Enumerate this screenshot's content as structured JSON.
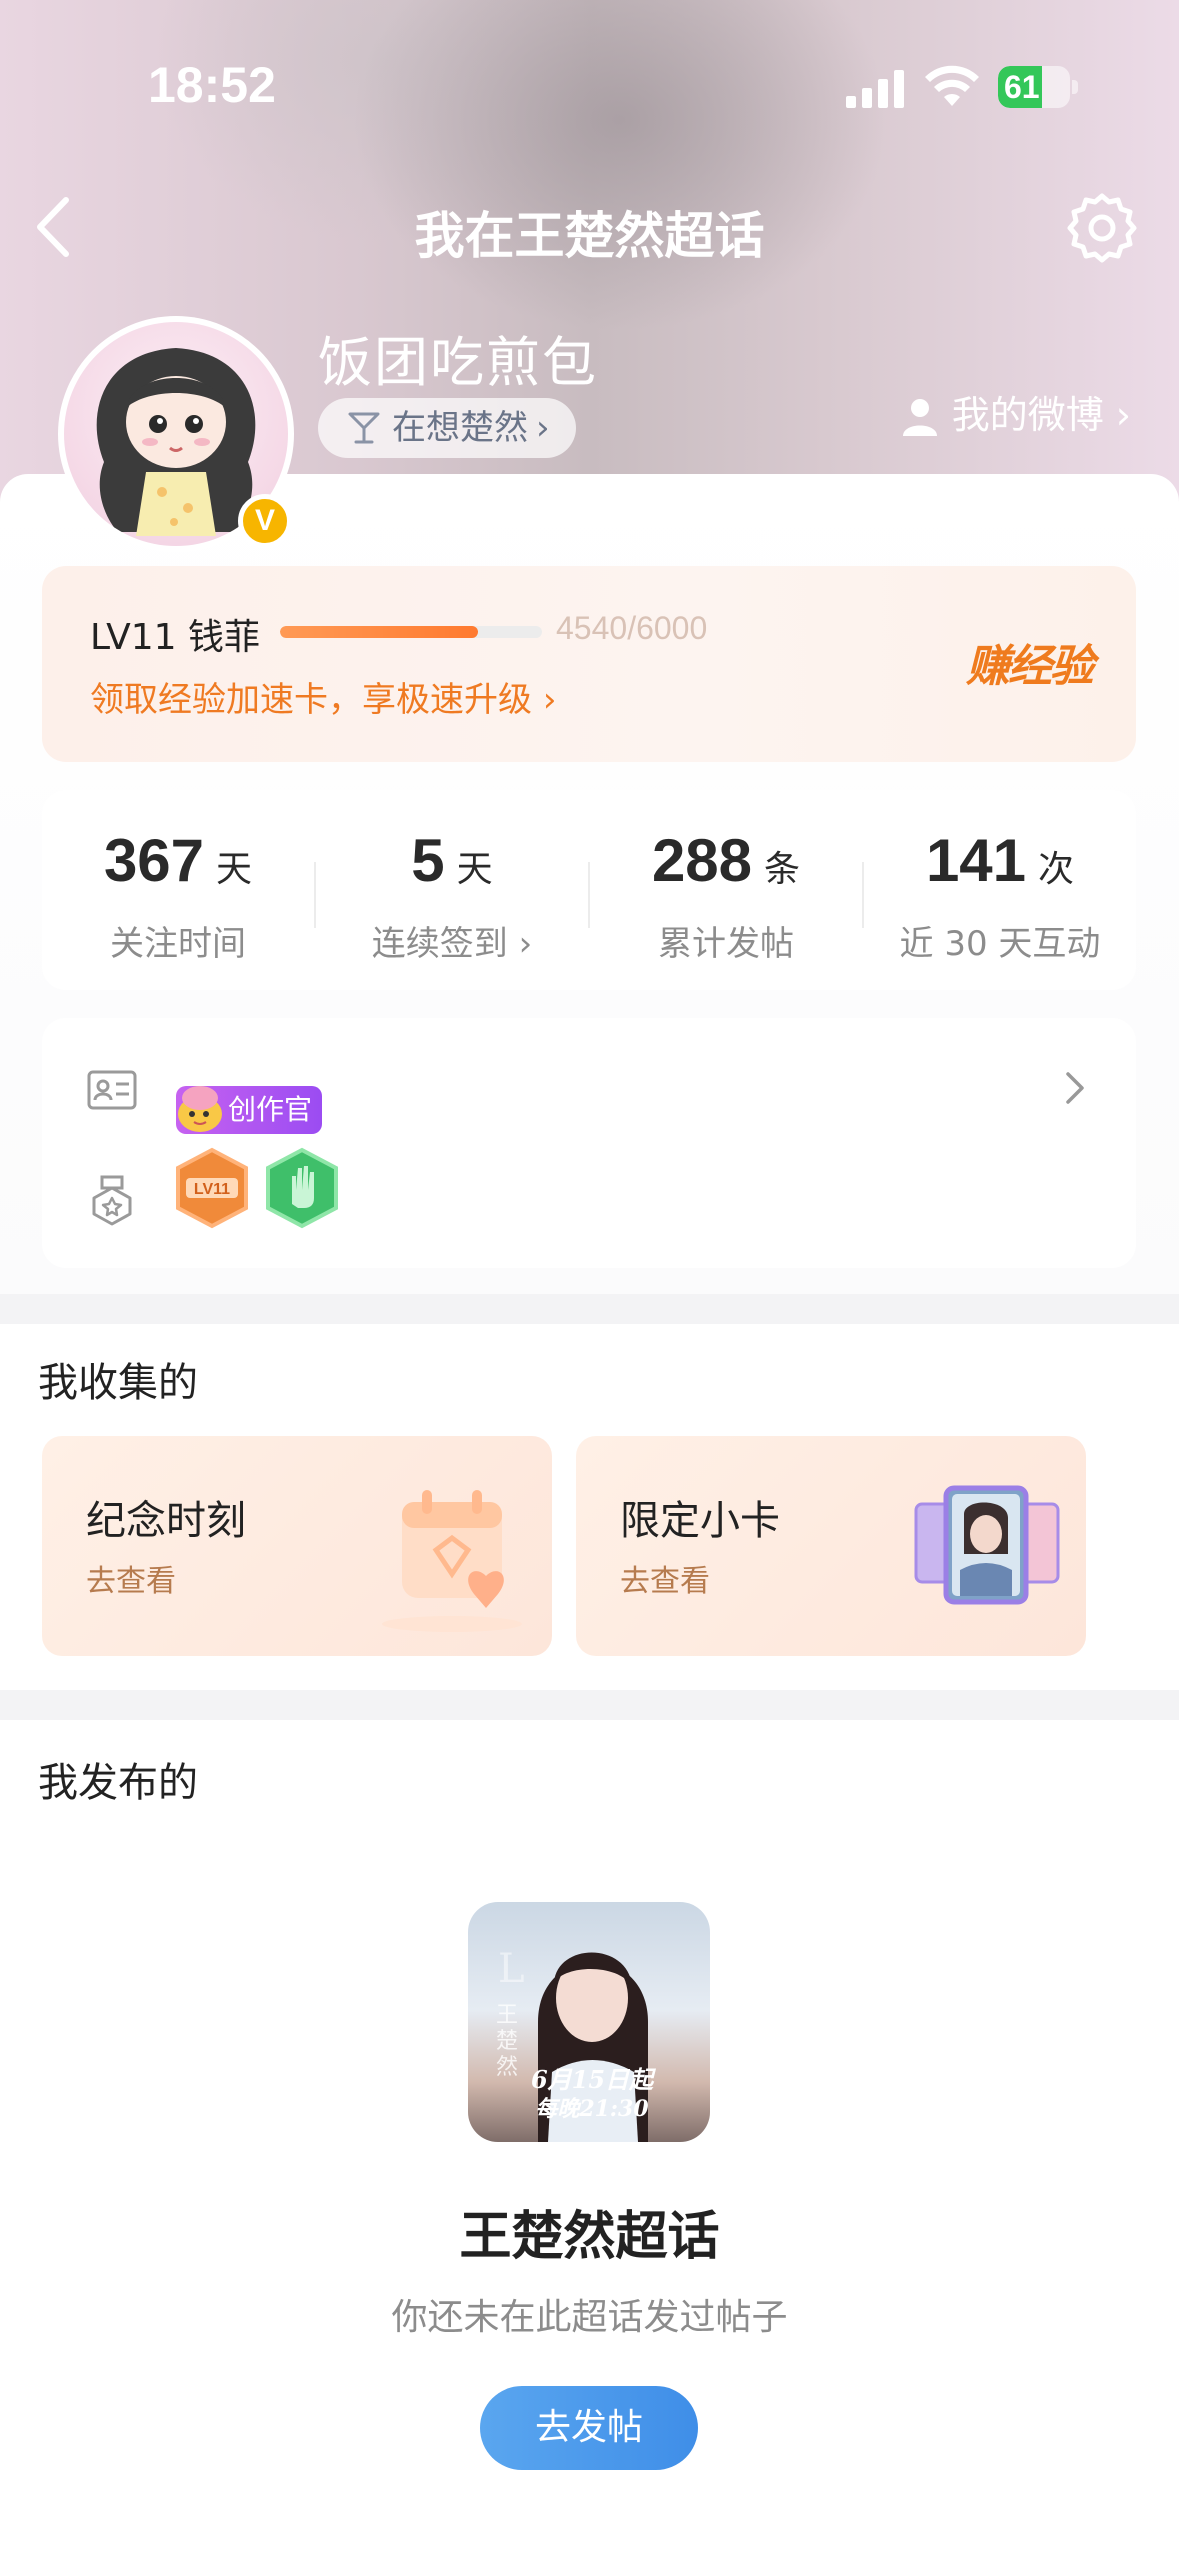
{
  "status_bar": {
    "time": "18:52",
    "battery": "61",
    "battery_level_percent": 61,
    "icons": [
      "signal-icon",
      "wifi-icon",
      "battery-charging-icon"
    ]
  },
  "nav": {
    "title": "我在王楚然超话",
    "back_icon": "chevron-left-icon",
    "settings_icon": "gear-icon"
  },
  "profile": {
    "username": "饭团吃煎包",
    "status": "在想楚然",
    "status_chevron": "›",
    "my_weibo": "我的微博",
    "my_weibo_chevron": "›",
    "verified_mark": "V"
  },
  "level": {
    "label": "LV11 钱菲",
    "progress_text": "4540/6000",
    "progress_current": 4540,
    "progress_max": 6000,
    "promo": "领取经验加速卡，享极速升级",
    "promo_chevron": "›",
    "earn_button": "赚经验"
  },
  "stats": [
    {
      "value": "367",
      "unit": "天",
      "label": "关注时间"
    },
    {
      "value": "5",
      "unit": "天",
      "label": "连续签到 ›"
    },
    {
      "value": "288",
      "unit": "条",
      "label": "累计发帖"
    },
    {
      "value": "141",
      "unit": "次",
      "label": "近 30 天互动"
    }
  ],
  "badges": {
    "creator_tag": "创作官",
    "medal_level_text": "LV11"
  },
  "collected": {
    "title": "我收集的",
    "cards": [
      {
        "title": "纪念时刻",
        "sub": "去查看"
      },
      {
        "title": "限定小卡",
        "sub": "去查看"
      }
    ]
  },
  "published": {
    "title": "我发布的",
    "poster_text": "6月15日起",
    "poster_time": "每晚21:30",
    "topic_name": "王楚然超话",
    "empty_text": "你还未在此超话发过帖子",
    "post_button": "去发帖"
  },
  "colors": {
    "accent_orange": "#ef7a22",
    "progress_fill": "#ff7a2f",
    "button_blue": "#3f8ee8",
    "creator_purple": "#9b4cf2",
    "battery_green": "#34c759"
  }
}
